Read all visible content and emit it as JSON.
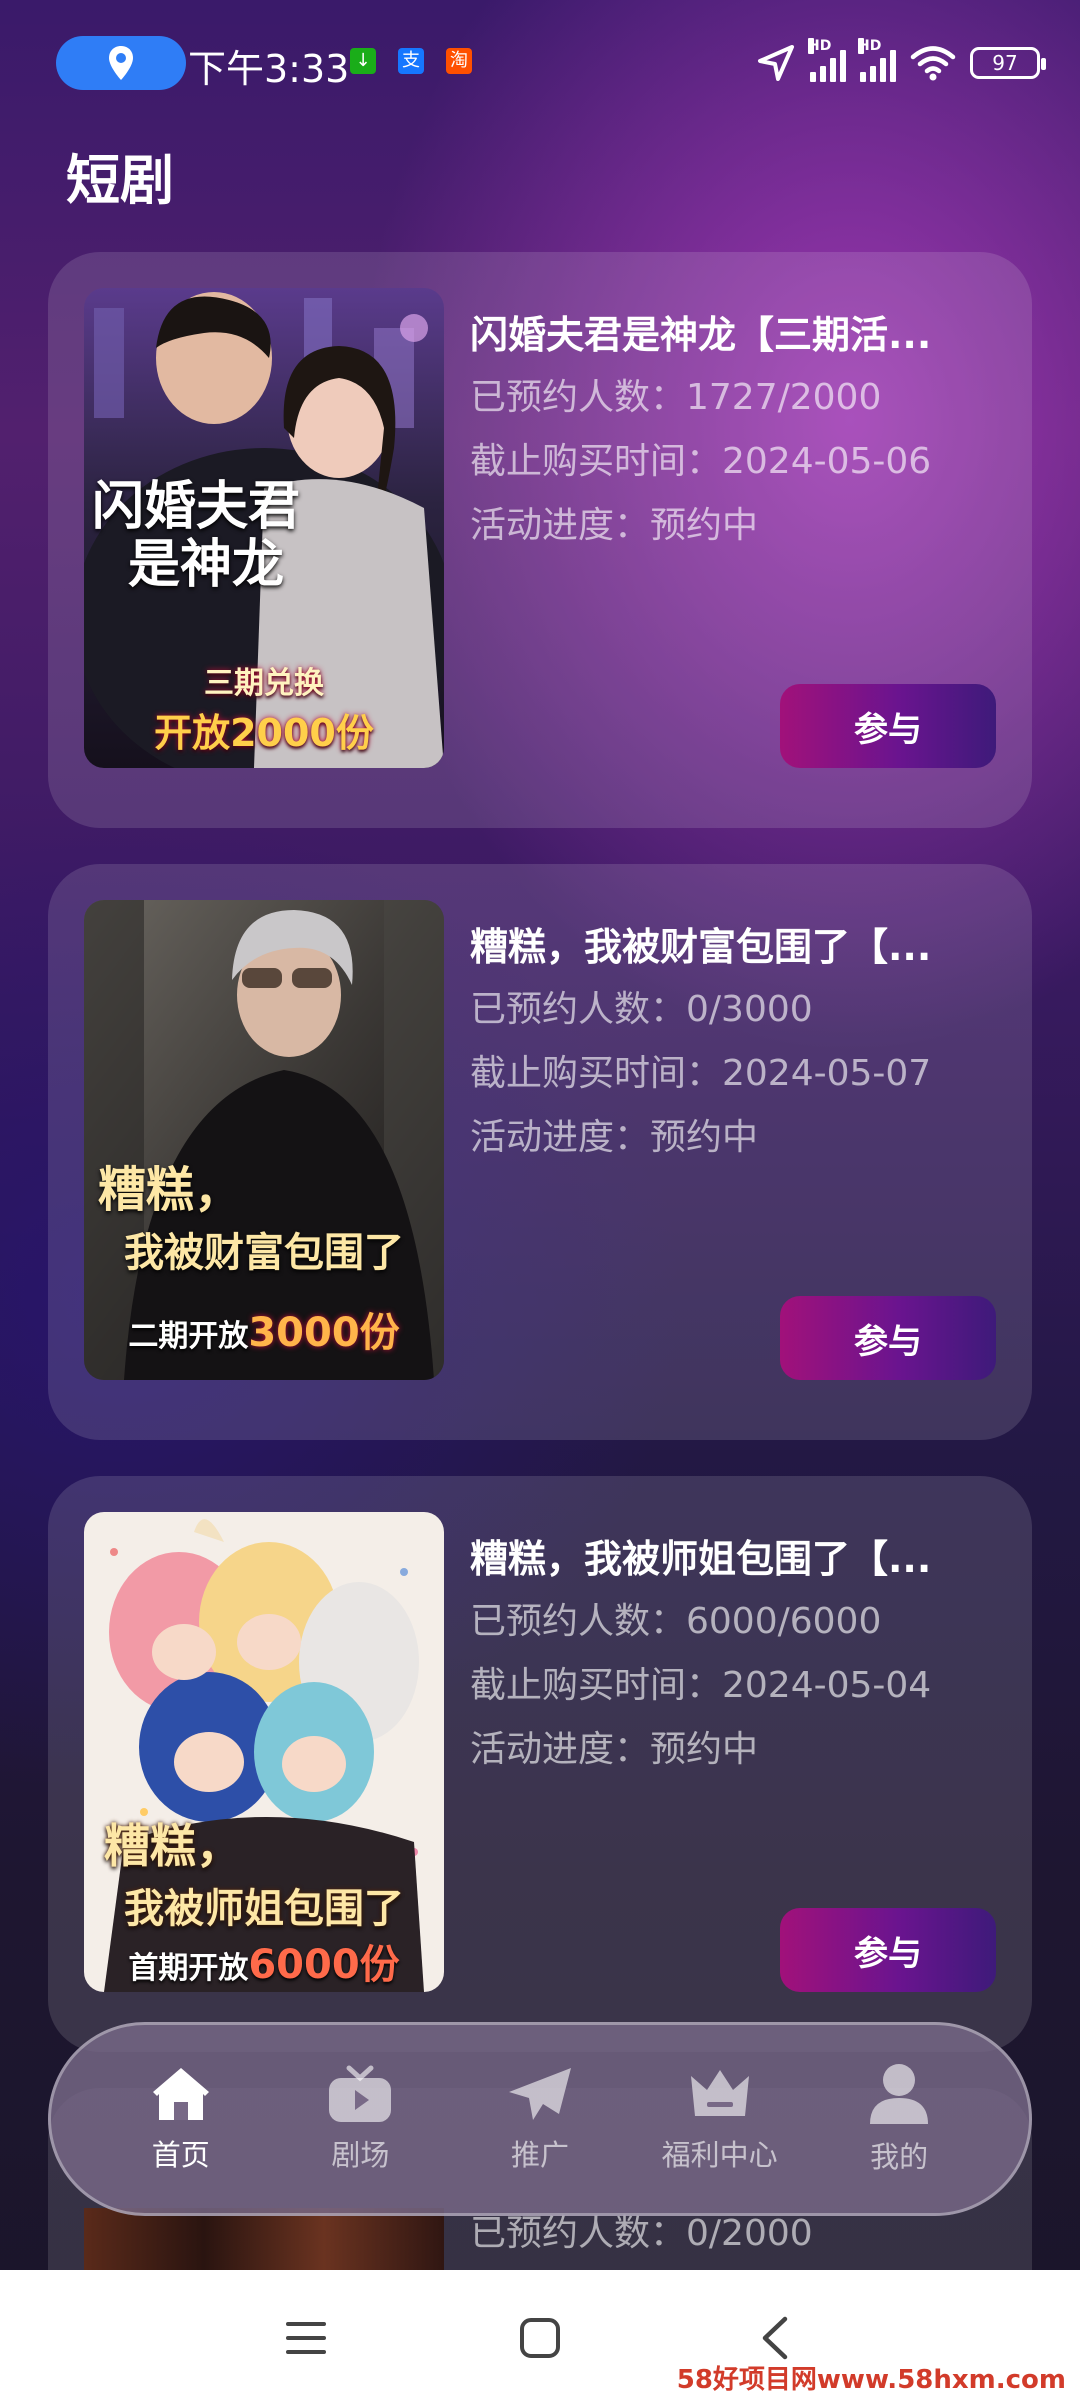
{
  "status_bar": {
    "time": "下午3:33",
    "battery": "97",
    "signal_label": "HD",
    "app_badges": [
      {
        "text": "↓",
        "color": "#1aad19"
      },
      {
        "text": "支",
        "color": "#1677ff"
      },
      {
        "text": "淘",
        "color": "#ff5000"
      }
    ]
  },
  "page": {
    "title": "短剧"
  },
  "cards": [
    {
      "title": "闪婚夫君是神龙【三期活...",
      "reserved": "已预约人数：1727/2000",
      "deadline": "截止购买时间：2024-05-06",
      "progress": "活动进度：预约中",
      "button": "参与",
      "poster": {
        "title_line1": "闪婚夫君",
        "title_line2": "是神龙",
        "tag_line1": "三期兑换",
        "tag_line2": "开放2000份"
      }
    },
    {
      "title": "糟糕，我被财富包围了【...",
      "reserved": "已预约人数：0/3000",
      "deadline": "截止购买时间：2024-05-07",
      "progress": "活动进度：预约中",
      "button": "参与",
      "poster": {
        "title_line1": "糟糕，",
        "title_line2": "我被财富包围了",
        "tag_line1": "二期开放",
        "tag_line2": "3000份"
      }
    },
    {
      "title": "糟糕，我被师姐包围了【...",
      "reserved": "已预约人数：6000/6000",
      "deadline": "截止购买时间：2024-05-04",
      "progress": "活动进度：预约中",
      "button": "参与",
      "poster": {
        "title_line1": "糟糕，",
        "title_line2": "我被师姐包围了",
        "tag_line1": "首期开放",
        "tag_line2": "6000份"
      }
    }
  ],
  "partial_card": {
    "reserved": "已预约人数：0/2000"
  },
  "bottom_nav": [
    {
      "label": "首页",
      "icon": "home-icon",
      "active": true
    },
    {
      "label": "剧场",
      "icon": "tv-icon",
      "active": false
    },
    {
      "label": "推广",
      "icon": "paper-plane-icon",
      "active": false
    },
    {
      "label": "福利中心",
      "icon": "crown-icon",
      "active": false
    },
    {
      "label": "我的",
      "icon": "user-icon",
      "active": false
    }
  ],
  "system_nav": [
    "menu-icon",
    "home-square-icon",
    "back-icon"
  ],
  "watermark": "58好项目网www.58hxm.com",
  "colors": {
    "accent": "#a1117a",
    "location_pill": "#2f7df6"
  }
}
